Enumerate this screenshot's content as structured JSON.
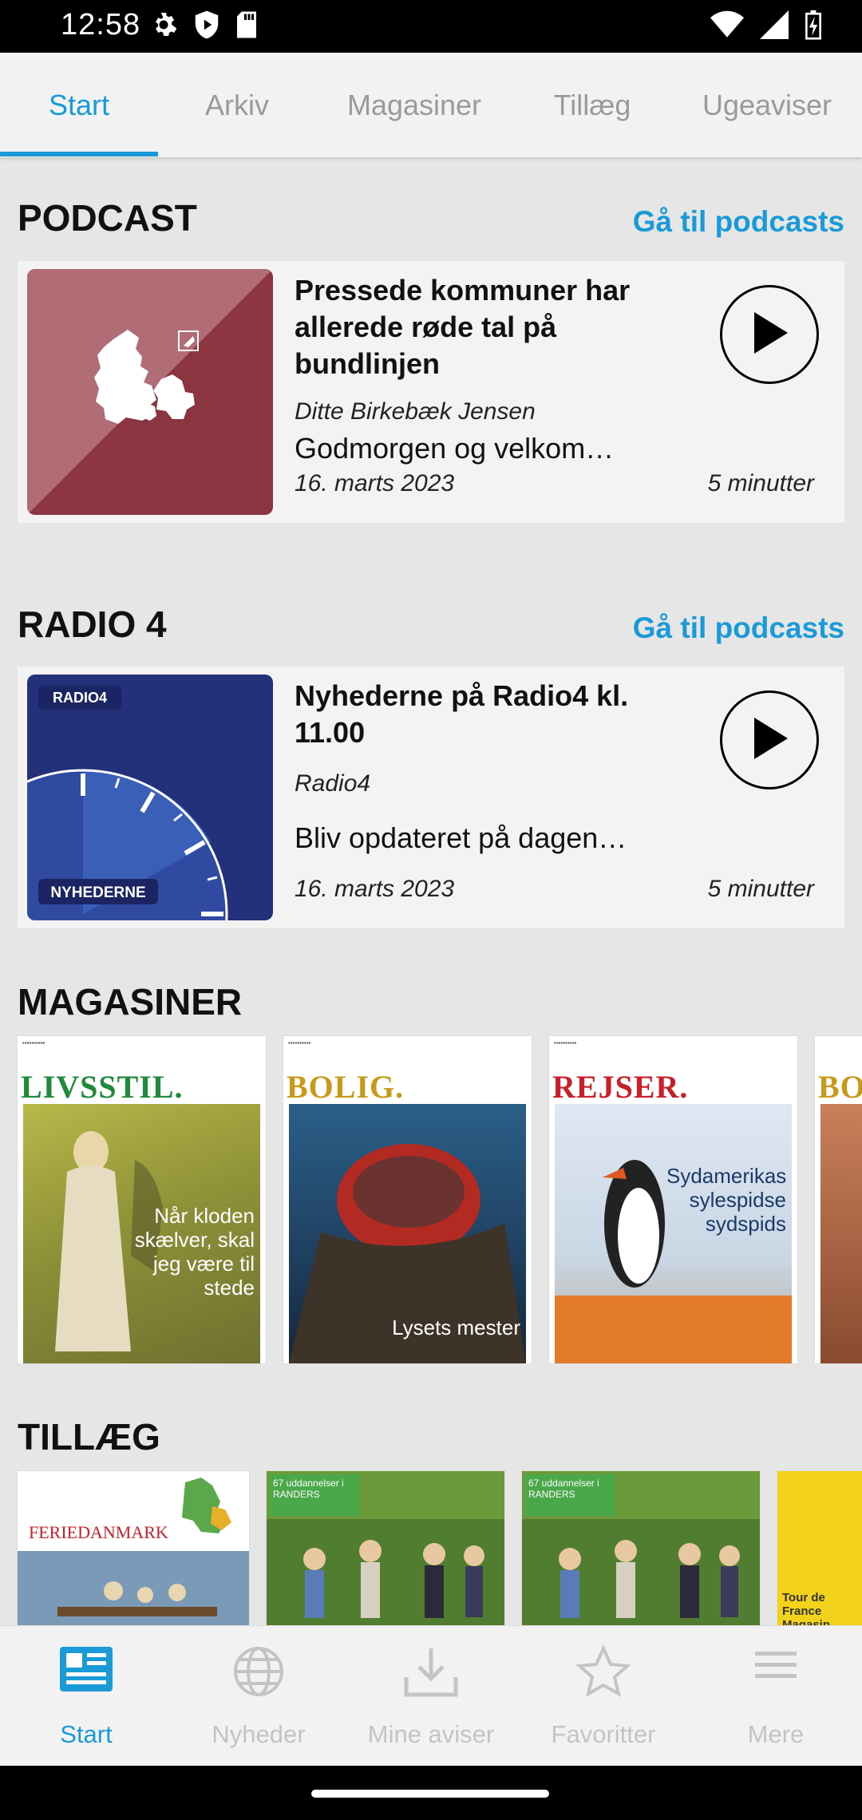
{
  "status_bar": {
    "time": "12:58",
    "icons_left": [
      "settings-icon",
      "shield-icon",
      "sd-card-icon"
    ],
    "icons_right": [
      "wifi-icon",
      "signal-icon",
      "battery-charging-icon"
    ]
  },
  "tabs": [
    {
      "label": "Start",
      "active": true
    },
    {
      "label": "Arkiv",
      "active": false
    },
    {
      "label": "Magasiner",
      "active": false
    },
    {
      "label": "Tillæg",
      "active": false
    },
    {
      "label": "Ugeaviser",
      "active": false
    }
  ],
  "podcast_section": {
    "title": "PODCAST",
    "link": "Gå til podcasts",
    "card": {
      "title": "Pressede kommuner har allerede røde tal på bundlinjen",
      "author": "Ditte Birkebæk Jensen",
      "description": "Godmorgen og velkom…",
      "date": "16. marts 2023",
      "duration": "5 minutter",
      "thumb_color": "#8a3540"
    }
  },
  "radio_section": {
    "title": "RADIO 4",
    "link": "Gå til podcasts",
    "card": {
      "title": "Nyhederne på Radio4 kl. 11.00",
      "author": "Radio4",
      "description": "Bliv opdateret på dagen…",
      "date": "16. marts 2023",
      "duration": "5 minutter",
      "thumb_badge_top": "RADIO4",
      "thumb_badge_bottom": "NYHEDERNE",
      "thumb_color": "#2a3a8a"
    }
  },
  "magasiner_section": {
    "title": "MAGASINER",
    "covers": [
      {
        "masthead": "LIVSSTIL.",
        "masthead_color": "#1f8a3a",
        "caption": "Når kloden skælver, skal jeg være til stede"
      },
      {
        "masthead": "BOLIG.",
        "masthead_color": "#c99a1a",
        "caption": "Lysets mester"
      },
      {
        "masthead": "REJSER.",
        "masthead_color": "#c8202a",
        "caption": "Sydamerikas sylespidse sydspids"
      },
      {
        "masthead": "BO",
        "masthead_color": "#c99a1a",
        "caption": ""
      }
    ]
  },
  "tillaeg_section": {
    "title": "TILLÆG",
    "covers": [
      {
        "masthead": "FERIEDANMARK"
      },
      {
        "masthead": "67 uddannelser i RANDERS"
      },
      {
        "masthead": "67 uddannelser i RANDERS"
      },
      {
        "masthead": "Tour de France Magasin"
      }
    ]
  },
  "bottom_nav": [
    {
      "label": "Start",
      "icon": "newspaper-icon",
      "active": true
    },
    {
      "label": "Nyheder",
      "icon": "globe-icon",
      "active": false
    },
    {
      "label": "Mine aviser",
      "icon": "download-icon",
      "active": false
    },
    {
      "label": "Favoritter",
      "icon": "star-icon",
      "active": false
    },
    {
      "label": "Mere",
      "icon": "menu-icon",
      "active": false
    }
  ],
  "colors": {
    "accent": "#1a9ad6",
    "background": "#e6e6e6",
    "card": "#f3f3f3"
  }
}
